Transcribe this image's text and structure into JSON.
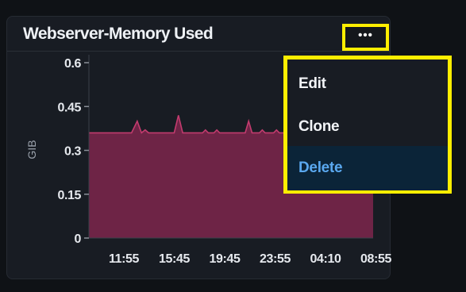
{
  "panel": {
    "title": "Webserver-Memory Used",
    "more_label": "•••",
    "more_icon": "ellipsis-icon"
  },
  "menu": {
    "items": [
      {
        "label": "Edit"
      },
      {
        "label": "Clone"
      },
      {
        "label": "Delete"
      }
    ]
  },
  "colors": {
    "highlight": "#ffee00",
    "area_fill": "#6e2446",
    "area_line": "#c23b6e",
    "delete_text": "#5aa8ef"
  },
  "chart_data": {
    "type": "area",
    "ylabel": "GIB",
    "ylim": [
      0,
      0.6
    ],
    "yticks": [
      {
        "value": 0,
        "label": "0"
      },
      {
        "value": 0.15,
        "label": "0.15"
      },
      {
        "value": 0.3,
        "label": "0.3"
      },
      {
        "value": 0.45,
        "label": "0.45"
      },
      {
        "value": 0.6,
        "label": "0.6"
      }
    ],
    "xticks": [
      "11:55",
      "15:45",
      "19:45",
      "23:55",
      "04:10",
      "08:55"
    ],
    "xlim": [
      0,
      100
    ],
    "grid": false,
    "series": [
      {
        "values": [
          [
            0,
            0.36
          ],
          [
            15,
            0.36
          ],
          [
            17,
            0.4
          ],
          [
            18.5,
            0.36
          ],
          [
            19.8,
            0.37
          ],
          [
            21,
            0.36
          ],
          [
            30,
            0.36
          ],
          [
            31.5,
            0.42
          ],
          [
            33,
            0.36
          ],
          [
            40,
            0.36
          ],
          [
            41,
            0.37
          ],
          [
            42,
            0.36
          ],
          [
            44,
            0.36
          ],
          [
            45,
            0.37
          ],
          [
            46,
            0.36
          ],
          [
            55,
            0.36
          ],
          [
            56.2,
            0.4
          ],
          [
            57.4,
            0.36
          ],
          [
            60,
            0.36
          ],
          [
            61,
            0.37
          ],
          [
            62,
            0.36
          ],
          [
            65,
            0.36
          ],
          [
            66,
            0.37
          ],
          [
            67,
            0.36
          ],
          [
            69,
            0.36
          ],
          [
            70.7,
            0.42
          ],
          [
            72.4,
            0.36
          ],
          [
            76,
            0.36
          ],
          [
            77,
            0.37
          ],
          [
            78,
            0.36
          ],
          [
            84,
            0.36
          ],
          [
            100,
            0.36
          ]
        ]
      }
    ]
  }
}
